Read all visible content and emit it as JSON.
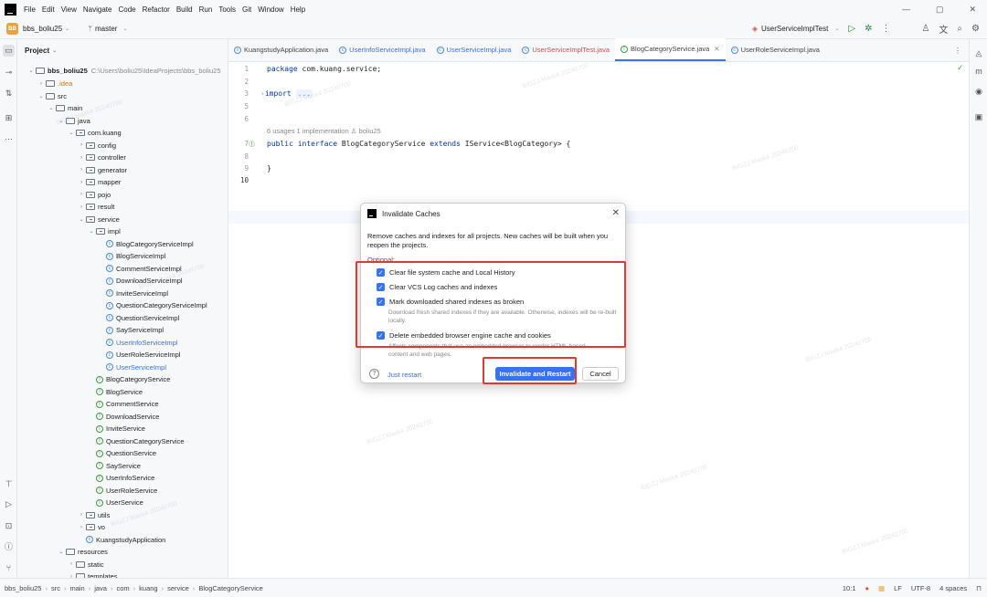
{
  "menubar": {
    "items": [
      "File",
      "Edit",
      "View",
      "Navigate",
      "Code",
      "Refactor",
      "Build",
      "Run",
      "Tools",
      "Git",
      "Window",
      "Help"
    ],
    "minimize": "—",
    "maximize": "▢",
    "close": "✕"
  },
  "toolbar": {
    "project_badge": "BB",
    "project_name": "bbs_boliu25",
    "branch": "master",
    "run_config": "UserServiceImplTest"
  },
  "project_panel": {
    "title": "Project",
    "root_name": "bbs_boliu25",
    "root_path": "C:\\Users\\boliu25\\IdeaProjects\\bbs_boliu25",
    "tree": [
      {
        "label": ".idea",
        "type": "folder",
        "depth": 1,
        "arrow": "›",
        "color": "orange"
      },
      {
        "label": "src",
        "type": "folder",
        "depth": 1,
        "arrow": "⌄"
      },
      {
        "label": "main",
        "type": "folder",
        "depth": 2,
        "arrow": "⌄"
      },
      {
        "label": "java",
        "type": "folder",
        "depth": 3,
        "arrow": "⌄"
      },
      {
        "label": "com.kuang",
        "type": "pkg",
        "depth": 4,
        "arrow": "⌄"
      },
      {
        "label": "config",
        "type": "pkg",
        "depth": 5,
        "arrow": "›"
      },
      {
        "label": "controller",
        "type": "pkg",
        "depth": 5,
        "arrow": "›"
      },
      {
        "label": "generator",
        "type": "pkg",
        "depth": 5,
        "arrow": "›"
      },
      {
        "label": "mapper",
        "type": "pkg",
        "depth": 5,
        "arrow": "›"
      },
      {
        "label": "pojo",
        "type": "pkg",
        "depth": 5,
        "arrow": "›"
      },
      {
        "label": "result",
        "type": "pkg",
        "depth": 5,
        "arrow": "›"
      },
      {
        "label": "service",
        "type": "pkg",
        "depth": 5,
        "arrow": "⌄"
      },
      {
        "label": "impl",
        "type": "pkg",
        "depth": 6,
        "arrow": "⌄"
      },
      {
        "label": "BlogCategoryServiceImpl",
        "type": "cls",
        "depth": 7
      },
      {
        "label": "BlogServiceImpl",
        "type": "cls",
        "depth": 7
      },
      {
        "label": "CommentServiceImpl",
        "type": "cls",
        "depth": 7
      },
      {
        "label": "DownloadServiceImpl",
        "type": "cls",
        "depth": 7
      },
      {
        "label": "InviteServiceImpl",
        "type": "cls",
        "depth": 7
      },
      {
        "label": "QuestionCategoryServiceImpl",
        "type": "cls",
        "depth": 7
      },
      {
        "label": "QuestionServiceImpl",
        "type": "cls",
        "depth": 7
      },
      {
        "label": "SayServiceImpl",
        "type": "cls",
        "depth": 7
      },
      {
        "label": "UserInfoServiceImpl",
        "type": "cls",
        "depth": 7,
        "color": "blue"
      },
      {
        "label": "UserRoleServiceImpl",
        "type": "cls",
        "depth": 7
      },
      {
        "label": "UserServiceImpl",
        "type": "cls",
        "depth": 7,
        "color": "blue"
      },
      {
        "label": "BlogCategoryService",
        "type": "intf",
        "depth": 6
      },
      {
        "label": "BlogService",
        "type": "intf",
        "depth": 6
      },
      {
        "label": "CommentService",
        "type": "intf",
        "depth": 6
      },
      {
        "label": "DownloadService",
        "type": "intf",
        "depth": 6
      },
      {
        "label": "InviteService",
        "type": "intf",
        "depth": 6
      },
      {
        "label": "QuestionCategoryService",
        "type": "intf",
        "depth": 6
      },
      {
        "label": "QuestionService",
        "type": "intf",
        "depth": 6
      },
      {
        "label": "SayService",
        "type": "intf",
        "depth": 6
      },
      {
        "label": "UserInfoService",
        "type": "intf",
        "depth": 6
      },
      {
        "label": "UserRoleService",
        "type": "intf",
        "depth": 6
      },
      {
        "label": "UserService",
        "type": "intf",
        "depth": 6
      },
      {
        "label": "utils",
        "type": "pkg",
        "depth": 5,
        "arrow": "›"
      },
      {
        "label": "vo",
        "type": "pkg",
        "depth": 5,
        "arrow": "›"
      },
      {
        "label": "KuangstudyApplication",
        "type": "cls",
        "depth": 5
      },
      {
        "label": "resources",
        "type": "folder",
        "depth": 3,
        "arrow": "⌄"
      },
      {
        "label": "static",
        "type": "folder",
        "depth": 4,
        "arrow": "›"
      },
      {
        "label": "templates",
        "type": "folder",
        "depth": 4,
        "arrow": "›"
      }
    ]
  },
  "editor": {
    "tabs": [
      {
        "label": "KuangstudyApplication.java",
        "kind": "cls",
        "style": ""
      },
      {
        "label": "UserInfoServiceImpl.java",
        "kind": "cls",
        "style": "blue"
      },
      {
        "label": "UserServiceImpl.java",
        "kind": "cls",
        "style": "blue"
      },
      {
        "label": "UserServiceImplTest.java",
        "kind": "cls",
        "style": "red"
      },
      {
        "label": "BlogCategoryService.java",
        "kind": "intf",
        "style": "active"
      },
      {
        "label": "UserRoleServiceImpl.java",
        "kind": "cls",
        "style": ""
      }
    ],
    "line_numbers": [
      "1",
      "2",
      "3",
      "5",
      "6",
      "7",
      "8",
      "9",
      "10"
    ],
    "code": {
      "l1_kw": "package",
      "l1_rest": " com.kuang.service;",
      "l3_kw": "import",
      "l3_fold": "...",
      "hint": "6 usages   1 implementation   ♙ boliu25",
      "l7_kw1": "public interface",
      "l7_mid": " BlogCategoryService ",
      "l7_kw2": "extends",
      "l7_rest": " IService<BlogCategory> {",
      "l9": "}"
    }
  },
  "dialog": {
    "title": "Invalidate Caches",
    "description": "Remove caches and indexes for all projects. New caches will be built when you reopen the projects.",
    "optional_label": "Optional:",
    "options": [
      {
        "label": "Clear file system cache and Local History",
        "checked": true
      },
      {
        "label": "Clear VCS Log caches and indexes",
        "checked": true
      },
      {
        "label": "Mark downloaded shared indexes as broken",
        "checked": true
      },
      {
        "label": "Delete embedded browser engine cache and cookies",
        "checked": true
      }
    ],
    "note_shared": "Download fresh shared indexes if they are available. Otherwise, indexes will be re-built locally.",
    "note_browser": "Affects components that use an embedded browser to render HTML-based content and web pages.",
    "help": "?",
    "just_restart": "Just restart",
    "primary_button": "Invalidate and Restart",
    "cancel_button": "Cancel"
  },
  "statusbar": {
    "breadcrumb": [
      "bbs_boliu25",
      "src",
      "main",
      "java",
      "com",
      "kuang",
      "service",
      "BlogCategoryService"
    ],
    "position": "10:1",
    "line_sep": "LF",
    "encoding": "UTF-8",
    "indent": "4 spaces"
  },
  "watermark": "BIGZJ Mask4 20240700",
  "colors": {
    "accent": "#3574f0",
    "highlight": "#e03a30"
  }
}
